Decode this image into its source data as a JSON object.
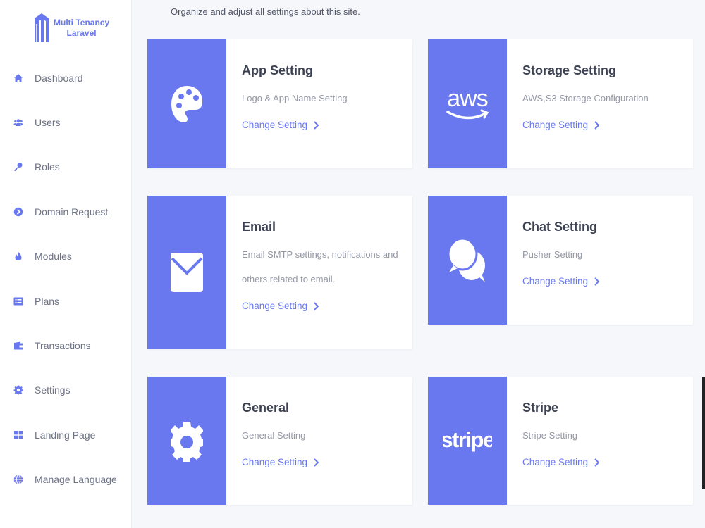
{
  "brand": {
    "line1": "Multi Tenancy",
    "line2": "Laravel"
  },
  "nav": [
    {
      "label": "Dashboard",
      "icon": "home-icon"
    },
    {
      "label": "Users",
      "icon": "users-icon"
    },
    {
      "label": "Roles",
      "icon": "key-icon"
    },
    {
      "label": "Domain Request",
      "icon": "arrow-circle-icon"
    },
    {
      "label": "Modules",
      "icon": "fire-icon"
    },
    {
      "label": "Plans",
      "icon": "list-icon"
    },
    {
      "label": "Transactions",
      "icon": "wallet-icon"
    },
    {
      "label": "Settings",
      "icon": "gear-icon"
    },
    {
      "label": "Landing Page",
      "icon": "grid-icon"
    },
    {
      "label": "Manage Language",
      "icon": "globe-icon"
    }
  ],
  "page": {
    "subtitle": "Organize and adjust all settings about this site."
  },
  "cards": [
    {
      "title": "App Setting",
      "desc": "Logo & App Name Setting",
      "link": "Change Setting",
      "icon": "palette-icon"
    },
    {
      "title": "Storage Setting",
      "desc": "AWS,S3 Storage Configuration",
      "link": "Change Setting",
      "icon": "aws-logo",
      "logo_text": "aws"
    },
    {
      "title": "Email",
      "desc": "Email SMTP settings, notifications and others related to email.",
      "link": "Change Setting",
      "icon": "envelope-icon"
    },
    {
      "title": "Chat Setting",
      "desc": "Pusher Setting",
      "link": "Change Setting",
      "icon": "chat-bubbles-icon"
    },
    {
      "title": "General",
      "desc": "General Setting",
      "link": "Change Setting",
      "icon": "gear-icon"
    },
    {
      "title": "Stripe",
      "desc": "Stripe Setting",
      "link": "Change Setting",
      "icon": "stripe-logo",
      "logo_text": "stripe"
    }
  ],
  "colors": {
    "accent": "#6a78f0",
    "background": "#f6f7fb"
  }
}
